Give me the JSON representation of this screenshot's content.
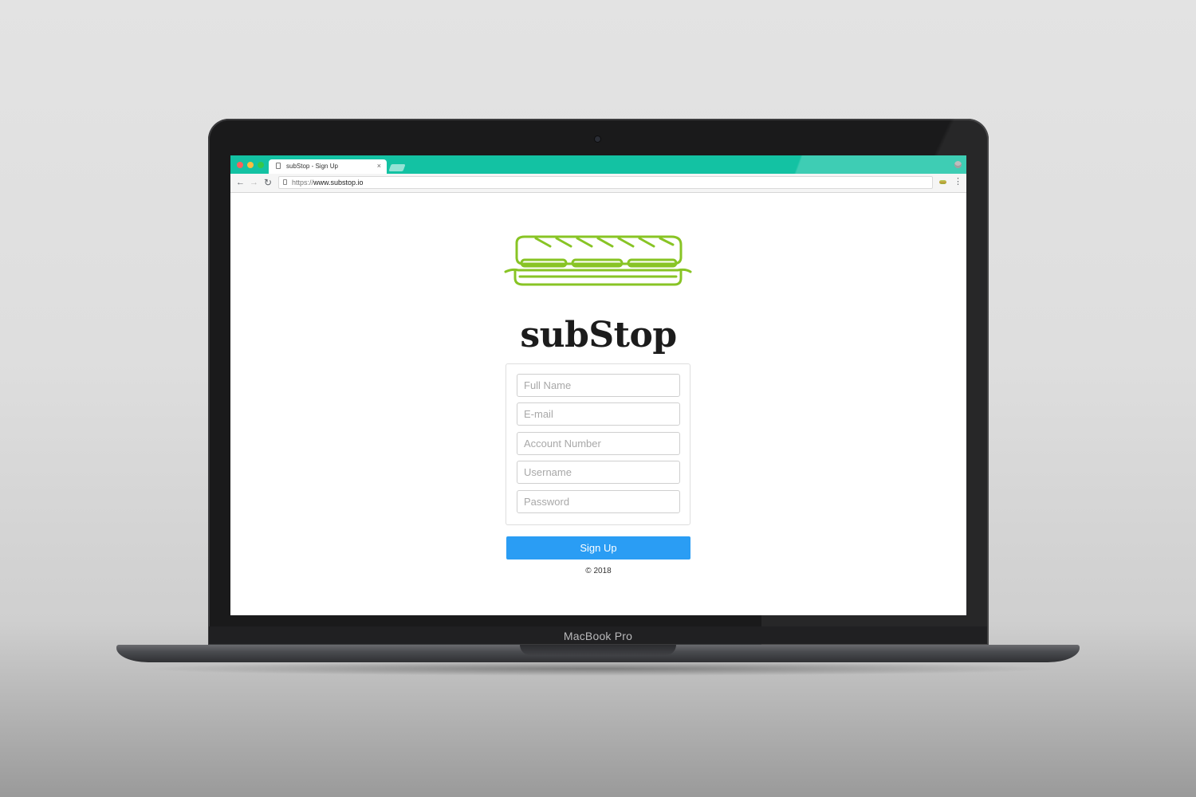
{
  "device": {
    "label": "MacBook Pro"
  },
  "browser": {
    "tab_title": "subStop - Sign Up",
    "tab_close": "×",
    "url_scheme": "https://",
    "url_host": "www.substop.io",
    "accent_color": "#13c2a3"
  },
  "page": {
    "brand_name": "subStop",
    "logo_color": "#88c425",
    "form": {
      "fields": [
        {
          "placeholder": "Full Name",
          "value": ""
        },
        {
          "placeholder": "E-mail",
          "value": ""
        },
        {
          "placeholder": "Account Number",
          "value": ""
        },
        {
          "placeholder": "Username",
          "value": ""
        },
        {
          "placeholder": "Password",
          "value": ""
        }
      ],
      "submit_label": "Sign Up",
      "submit_color": "#2a9df4"
    },
    "footer": "© 2018"
  }
}
